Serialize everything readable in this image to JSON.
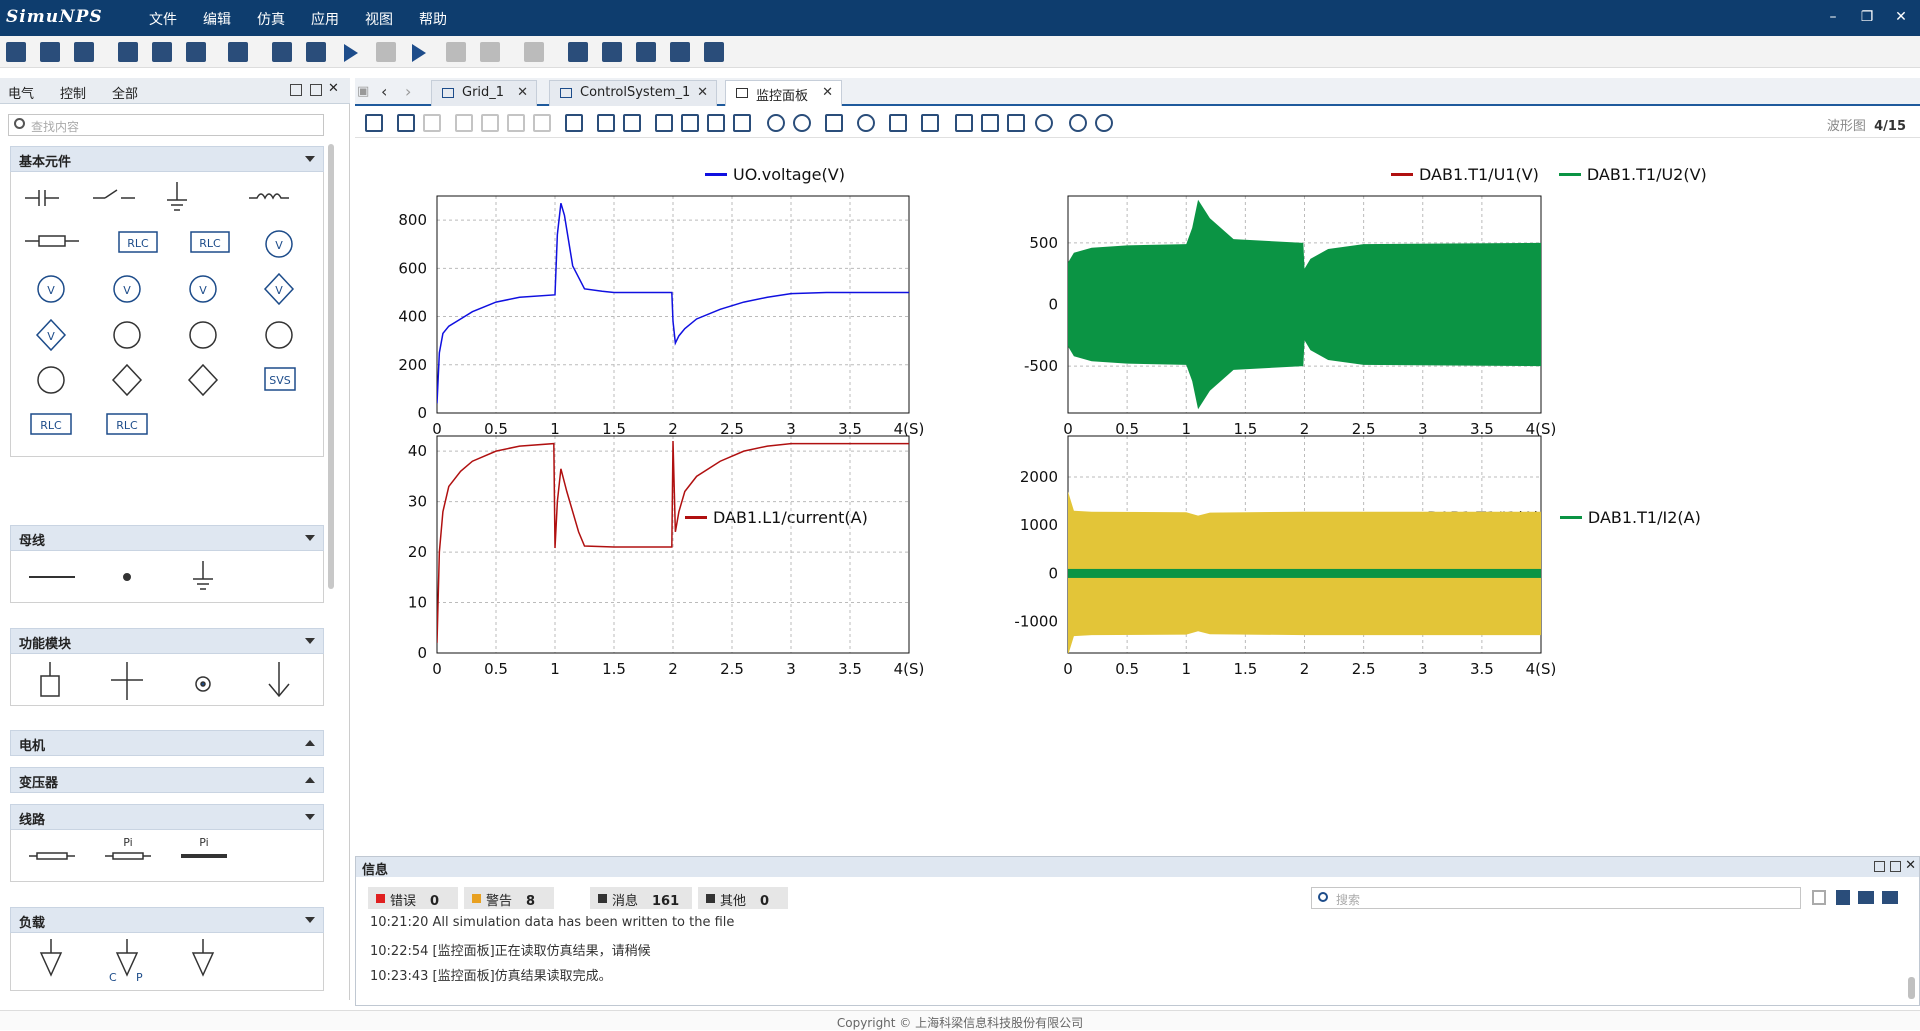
{
  "app": {
    "logo": "SimuNPS"
  },
  "menu": [
    "文件",
    "编辑",
    "仿真",
    "应用",
    "视图",
    "帮助"
  ],
  "left_panel": {
    "tabs": [
      "电气",
      "控制",
      "全部"
    ],
    "search_placeholder": "查找内容",
    "categories": [
      {
        "label": "基本元件",
        "expanded": true
      },
      {
        "label": "母线",
        "expanded": true
      },
      {
        "label": "功能模块",
        "expanded": true
      },
      {
        "label": "电机",
        "expanded": false
      },
      {
        "label": "变压器",
        "expanded": false
      },
      {
        "label": "线路",
        "expanded": true
      },
      {
        "label": "负载",
        "expanded": true
      }
    ],
    "symbol_labels": {
      "rlc": "RLC",
      "svs": "SVS",
      "pi": "Pi",
      "v": "V",
      "cvp_c": "C",
      "cvp_p": "P"
    }
  },
  "doc_tabs": [
    {
      "label": "Grid_1",
      "active": false
    },
    {
      "label": "ControlSystem_1",
      "active": false
    },
    {
      "label": "监控面板",
      "active": true
    }
  ],
  "wave_counter": {
    "label": "波形图",
    "value": "4/15"
  },
  "colors": {
    "blue": "#1010e0",
    "red": "#b01010",
    "green": "#0b9444",
    "yellow": "#e3c538",
    "titlebar": "#0e3d6e"
  },
  "chart_data": [
    {
      "type": "line",
      "series": [
        {
          "name": "UO.voltage(V)",
          "x": [
            0,
            0.02,
            0.05,
            0.1,
            0.2,
            0.3,
            0.5,
            0.7,
            1.0,
            1.02,
            1.05,
            1.08,
            1.15,
            1.25,
            1.4,
            1.5,
            1.99,
            2.0,
            2.02,
            2.05,
            2.1,
            2.2,
            2.4,
            2.6,
            2.8,
            3.0,
            3.3,
            4.0
          ],
          "y": [
            40,
            250,
            330,
            360,
            390,
            420,
            460,
            480,
            490,
            740,
            870,
            820,
            610,
            515,
            505,
            500,
            500,
            380,
            290,
            320,
            350,
            390,
            430,
            460,
            480,
            495,
            500,
            500
          ]
        }
      ],
      "x_ticks": [
        "0",
        "0.5",
        "1",
        "1.5",
        "2",
        "2.5",
        "3",
        "3.5",
        "4(S)"
      ],
      "y_ticks": [
        0,
        200,
        400,
        600,
        800
      ],
      "xlim": [
        0,
        4
      ],
      "ylim": [
        0,
        900
      ]
    },
    {
      "type": "line",
      "series": [
        {
          "name": "DAB1.T1/U1(V)",
          "x": [],
          "y": []
        },
        {
          "name": "DAB1.T1/U2(V)",
          "x": [
            0,
            0.05,
            0.2,
            0.5,
            1.0,
            1.05,
            1.1,
            1.2,
            1.4,
            1.99,
            2.0,
            2.05,
            2.2,
            2.5,
            4.0
          ],
          "y": [
            340,
            420,
            460,
            480,
            490,
            620,
            850,
            700,
            530,
            500,
            290,
            370,
            450,
            490,
            500
          ]
        }
      ],
      "x_ticks": [
        "0",
        "0.5",
        "1",
        "1.5",
        "2",
        "2.5",
        "3",
        "3.5",
        "4(S)"
      ],
      "y_ticks": [
        -500,
        0,
        500
      ],
      "xlim": [
        0,
        4
      ],
      "ylim": [
        -880,
        880
      ]
    },
    {
      "type": "line",
      "series": [
        {
          "name": "DAB1.L1/current(A)",
          "x": [
            0,
            0.02,
            0.05,
            0.1,
            0.2,
            0.3,
            0.5,
            0.7,
            0.99,
            1.0,
            1.02,
            1.05,
            1.1,
            1.2,
            1.25,
            1.5,
            1.99,
            2.0,
            2.02,
            2.05,
            2.1,
            2.2,
            2.4,
            2.6,
            2.8,
            3.0,
            4.0
          ],
          "y": [
            2,
            20,
            28,
            33,
            36,
            38,
            40,
            41,
            41.5,
            20.8,
            30,
            36.5,
            32,
            24,
            21.2,
            21,
            21,
            42,
            24,
            28,
            32,
            35,
            38,
            40,
            41,
            41.5,
            41.5
          ]
        }
      ],
      "x_ticks": [
        "0",
        "0.5",
        "1",
        "1.5",
        "2",
        "2.5",
        "3",
        "3.5",
        "4(S)"
      ],
      "y_ticks": [
        0,
        10,
        20,
        30,
        40
      ],
      "xlim": [
        0,
        4
      ],
      "ylim": [
        0,
        43
      ]
    },
    {
      "type": "line",
      "series": [
        {
          "name": "DAB1.T1/I1(A)",
          "x": [
            0,
            0.05,
            0.2,
            1.0,
            1.1,
            1.2,
            2.0,
            4.0
          ],
          "y": [
            1700,
            1300,
            1280,
            1270,
            1200,
            1260,
            1280,
            1280
          ]
        },
        {
          "name": "DAB1.T1/I2(A)",
          "x": [
            0,
            4.0
          ],
          "y": [
            0,
            0
          ]
        }
      ],
      "x_ticks": [
        "0",
        "0.5",
        "1",
        "1.5",
        "2",
        "2.5",
        "3",
        "3.5",
        "4(S)"
      ],
      "y_ticks": [
        -1000,
        0,
        1000,
        2000
      ],
      "xlim": [
        0,
        4
      ],
      "ylim": [
        -1650,
        2850
      ]
    }
  ],
  "info": {
    "title": "信息",
    "filters": [
      {
        "label": "错误",
        "count": "0",
        "color": "#e02020"
      },
      {
        "label": "警告",
        "count": "8",
        "color": "#e8a020"
      },
      {
        "label": "消息",
        "count": "161",
        "color": "#333333"
      },
      {
        "label": "其他",
        "count": "0",
        "color": "#333333"
      }
    ],
    "search_placeholder": "搜索",
    "log": [
      "10:21:20 All simulation data has been written to the file",
      "10:22:54 [监控面板]正在读取仿真结果，请稍候",
      "10:23:43 [监控面板]仿真结果读取完成。"
    ]
  },
  "footer": "Copyright © 上海科梁信息科技股份有限公司"
}
